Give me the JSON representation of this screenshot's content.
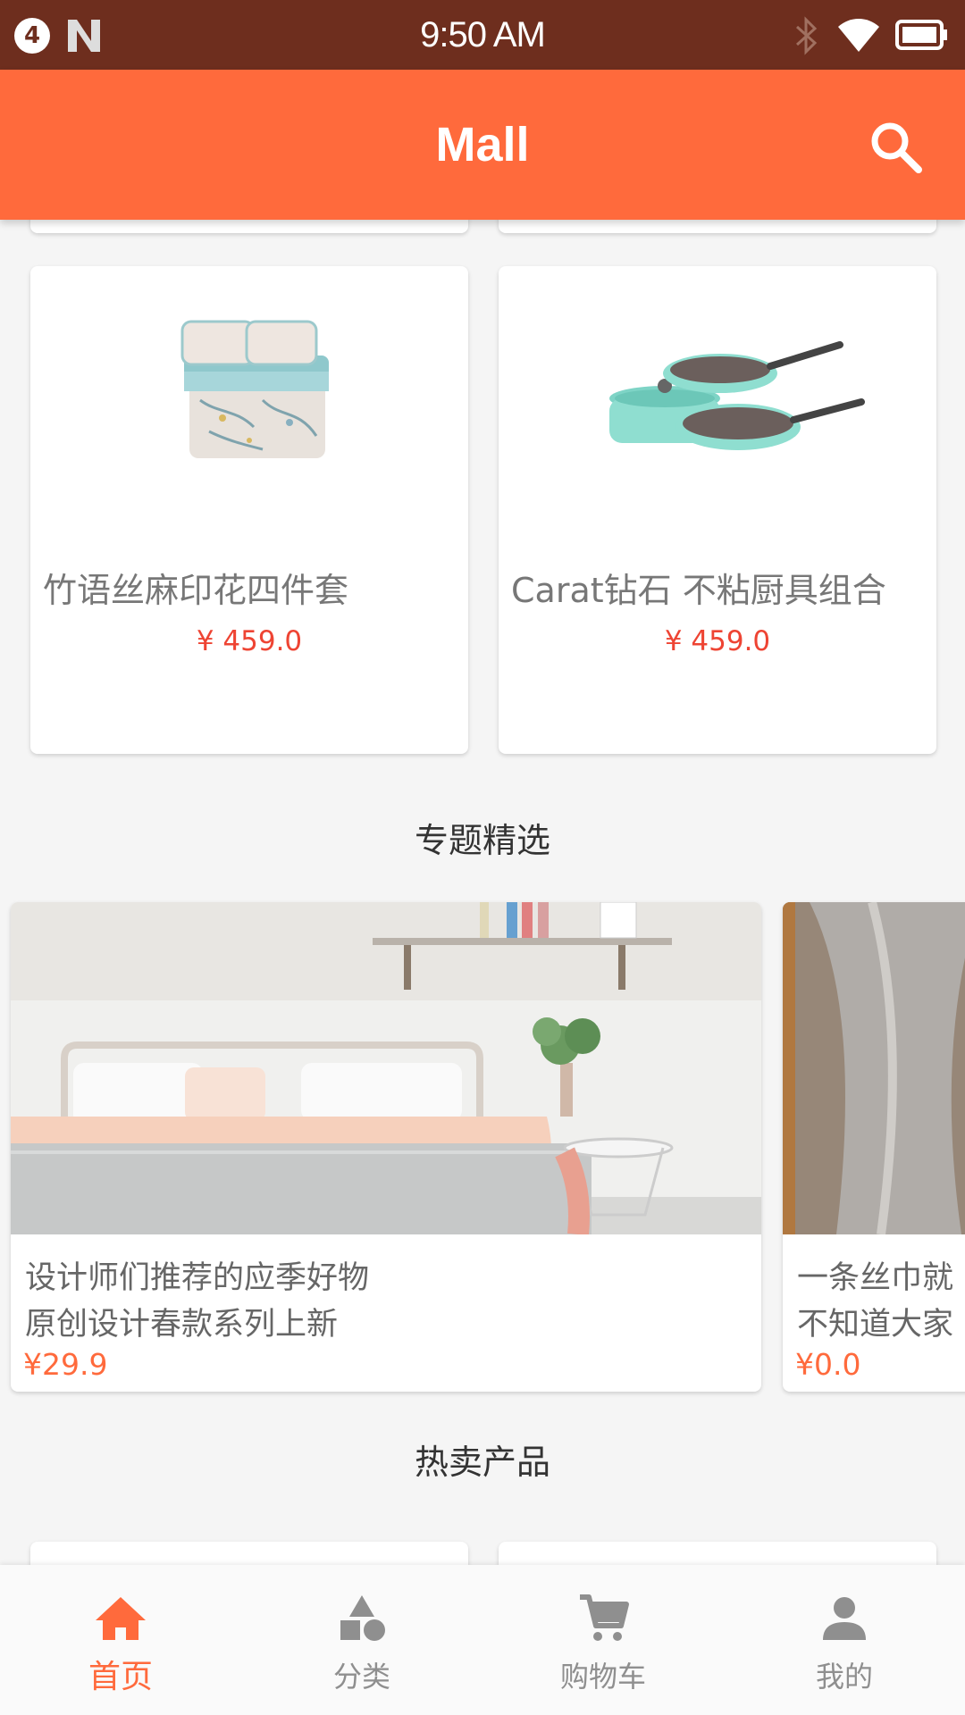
{
  "status_bar": {
    "notification_count": "4",
    "time": "9:50 AM"
  },
  "app_bar": {
    "title": "Mall",
    "search_icon": "search-icon"
  },
  "products": [
    {
      "name": "竹语丝麻印花四件套",
      "price": "¥ 459.0",
      "image": "bedding-set"
    },
    {
      "name": "Carat钻石 不粘厨具组合",
      "price": "¥ 459.0",
      "image": "cookware-set"
    }
  ],
  "sections": {
    "topics_title": "专题精选",
    "hot_title": "热卖产品"
  },
  "topics": [
    {
      "line1": "设计师们推荐的应季好物",
      "line2": "原创设计春款系列上新",
      "price": "¥29.9"
    },
    {
      "line1": "一条丝巾就",
      "line2": "不知道大家",
      "price": "¥0.0"
    }
  ],
  "nav": [
    {
      "label": "首页",
      "icon": "home-icon",
      "active": true
    },
    {
      "label": "分类",
      "icon": "category-icon",
      "active": false
    },
    {
      "label": "购物车",
      "icon": "cart-icon",
      "active": false
    },
    {
      "label": "我的",
      "icon": "person-icon",
      "active": false
    }
  ],
  "colors": {
    "status_bar": "#6e2e1e",
    "accent": "#ff6a3c",
    "price": "#ee4433"
  }
}
